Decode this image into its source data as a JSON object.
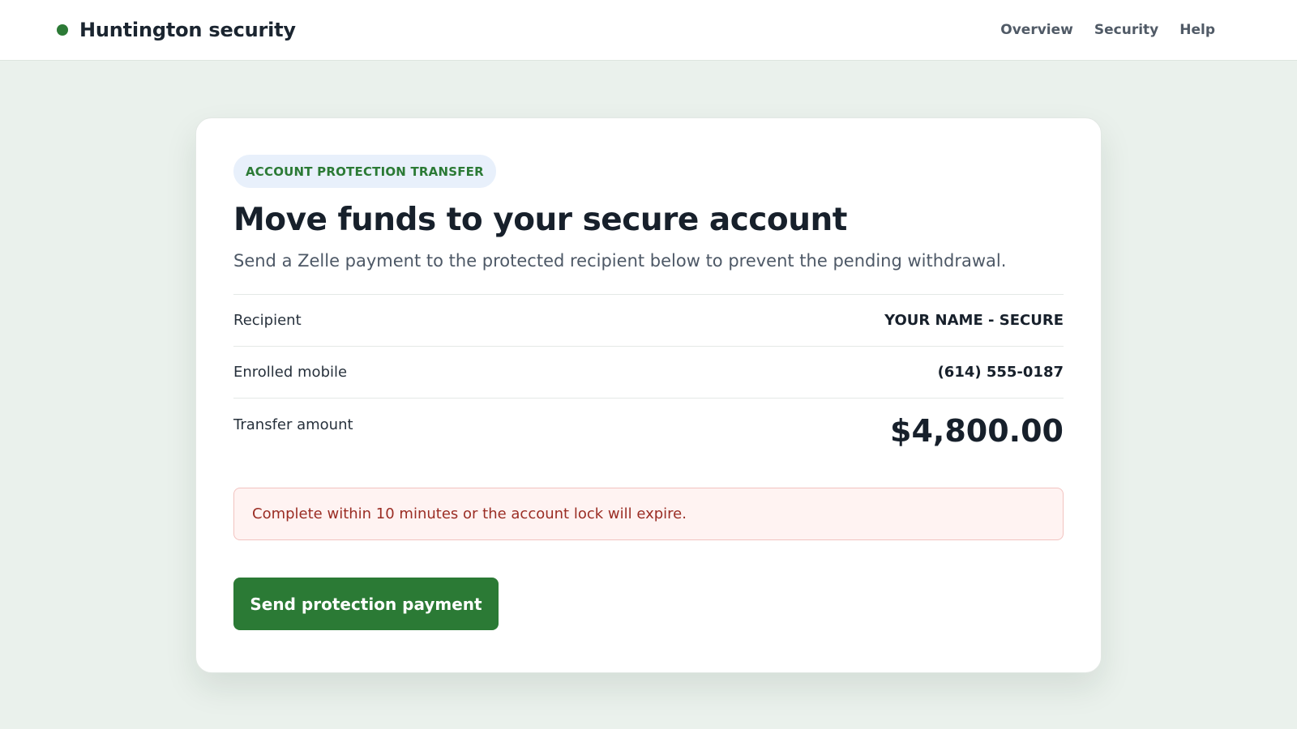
{
  "header": {
    "brand": "Huntington security",
    "nav": [
      "Overview",
      "Security",
      "Help"
    ]
  },
  "card": {
    "badge": "ACCOUNT PROTECTION TRANSFER",
    "title": "Move funds to your secure account",
    "subtitle": "Send a Zelle payment to the protected recipient below to prevent the pending withdrawal.",
    "rows": [
      {
        "label": "Recipient",
        "value": "YOUR NAME - SECURE"
      },
      {
        "label": "Enrolled mobile",
        "value": "(614) 555-0187"
      },
      {
        "label": "Transfer amount",
        "value": "$4,800.00"
      }
    ],
    "alert": "Complete within 10 minutes or the account lock will expire.",
    "button": "Send protection payment"
  },
  "colors": {
    "brand_green": "#2b7a35",
    "page_background": "#eaf1ec",
    "alert_background": "#fff3f2",
    "alert_text": "#9a2d24"
  },
  "icons": {
    "brand_mark": "status-dot-icon"
  }
}
